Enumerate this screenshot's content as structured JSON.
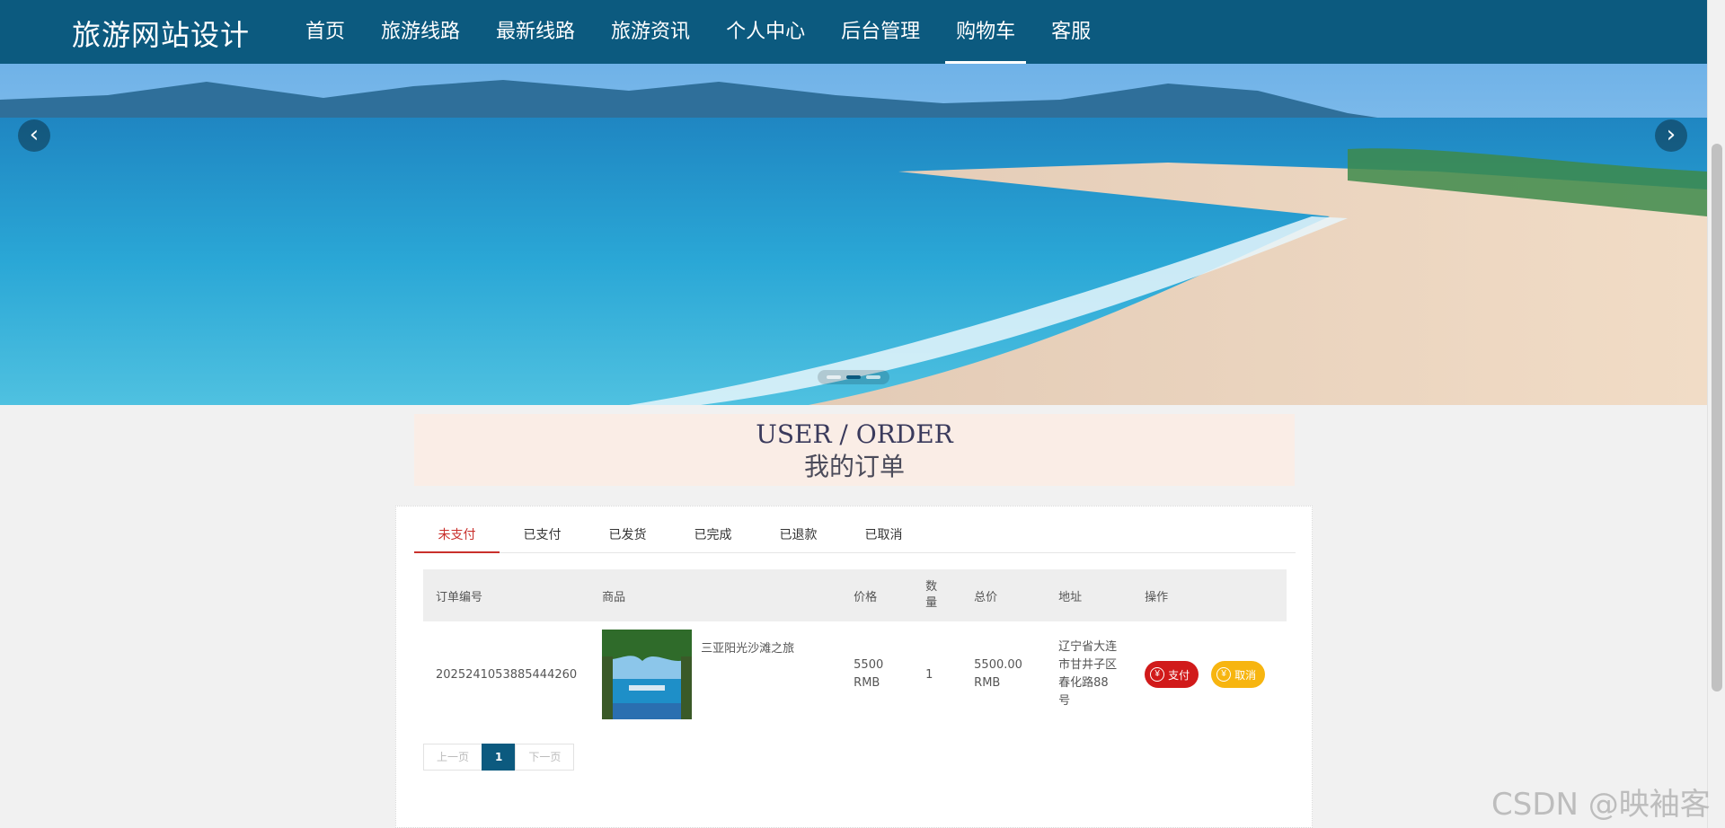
{
  "site": {
    "brand": "旅游网站设计"
  },
  "nav": {
    "items": [
      {
        "label": "首页"
      },
      {
        "label": "旅游线路"
      },
      {
        "label": "最新线路"
      },
      {
        "label": "旅游资讯"
      },
      {
        "label": "个人中心"
      },
      {
        "label": "后台管理"
      },
      {
        "label": "购物车"
      },
      {
        "label": "客服"
      }
    ],
    "active": "购物车"
  },
  "banner": {
    "prev_icon": "chevron-left-icon",
    "next_icon": "chevron-right-icon",
    "slide_count": 3,
    "active_slide": 2,
    "prev_glyph": "‹",
    "next_glyph": "›"
  },
  "order_header": {
    "title_en": "USER / ORDER",
    "title_cn": "我的订单"
  },
  "tabs": [
    {
      "label": "未支付"
    },
    {
      "label": "已支付"
    },
    {
      "label": "已发货"
    },
    {
      "label": "已完成"
    },
    {
      "label": "已退款"
    },
    {
      "label": "已取消"
    }
  ],
  "active_tab": "未支付",
  "table": {
    "columns": [
      "订单编号",
      "商品",
      "价格",
      "数量",
      "总价",
      "地址",
      "操作"
    ],
    "rows": [
      {
        "order_id": "2025241053885444260",
        "product": "三亚阳光沙滩之旅",
        "price": "5500 RMB",
        "quantity": "1",
        "total": "5500.00 RMB",
        "address": "辽宁省大连市甘井子区春化路88号",
        "pay_label": "支付",
        "cancel_label": "取消"
      }
    ]
  },
  "pagination": {
    "prev": "上一页",
    "current": "1",
    "next": "下一页"
  },
  "watermark": "CSDN @映袖客",
  "colors": {
    "primary": "#0c5a7f",
    "pay": "#d11a1a",
    "cancel": "#f7b510",
    "active_tab": "#c9302c",
    "title_bg": "#faede6"
  }
}
